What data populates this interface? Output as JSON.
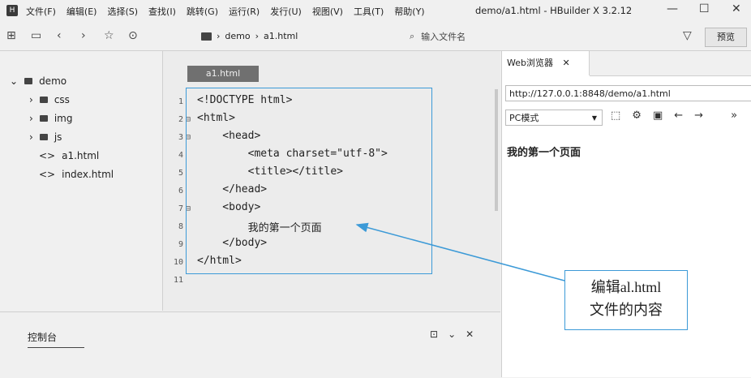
{
  "menubar": {
    "items": [
      "文件(F)",
      "编辑(E)",
      "选择(S)",
      "查找(I)",
      "跳转(G)",
      "运行(R)",
      "发行(U)",
      "视图(V)",
      "工具(T)",
      "帮助(Y)"
    ],
    "title": "demo/a1.html - HBuilder X 3.2.12",
    "minimize": "—",
    "maximize": "☐",
    "close": "✕"
  },
  "toolbar": {
    "breadcrumb": [
      "demo",
      "a1.html"
    ],
    "file_input_placeholder": "输入文件名",
    "preview_label": "预览"
  },
  "tree": {
    "root": "demo",
    "folders": [
      "css",
      "img",
      "js"
    ],
    "files": [
      "a1.html",
      "index.html"
    ]
  },
  "editor": {
    "tab": "a1.html",
    "line_numbers": [
      "1",
      "2",
      "3",
      "4",
      "5",
      "6",
      "7",
      "8",
      "9",
      "10",
      "11"
    ],
    "lines": [
      "<!DOCTYPE html>",
      "<html>",
      "    <head>",
      "        <meta charset=\"utf-8\">",
      "        <title></title>",
      "    </head>",
      "    <body>",
      "        我的第一个页面",
      "    </body>",
      "</html>",
      ""
    ]
  },
  "browser": {
    "tab_label": "Web浏览器",
    "url": "http://127.0.0.1:8848/demo/a1.html",
    "mode": "PC模式",
    "page_text": "我的第一个页面"
  },
  "console": {
    "tab_label": "控制台"
  },
  "annotation": {
    "line1": "编辑al.html",
    "line2": "文件的内容"
  },
  "colors": {
    "accent": "#3c9ad7"
  }
}
